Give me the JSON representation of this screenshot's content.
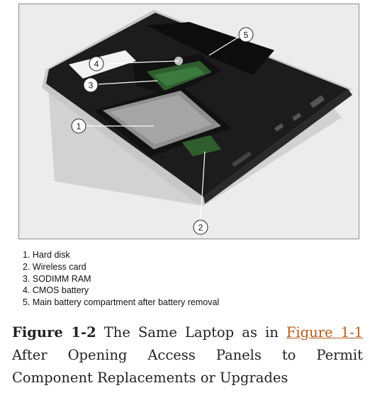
{
  "photo": {
    "description": "Laptop underside with access panels removed",
    "callouts": [
      "1",
      "2",
      "3",
      "4",
      "5"
    ]
  },
  "legend": [
    "1. Hard disk",
    "2. Wireless card",
    "3. SODIMM RAM",
    "4. CMOS battery",
    "5. Main battery compartment after battery removal"
  ],
  "caption": {
    "label": "Figure 1-2",
    "text_before_link": "The Same Laptop as in",
    "link_text": "Figure 1-1",
    "text_after_link": "After Opening Access Panels to Permit Component Replacements or Upgrades"
  },
  "colors": {
    "link": "#b35a1f",
    "laptop_body": "#1c1c1c",
    "laptop_rim": "#c9c9c9",
    "pcb_green": "#2f5d2f"
  }
}
